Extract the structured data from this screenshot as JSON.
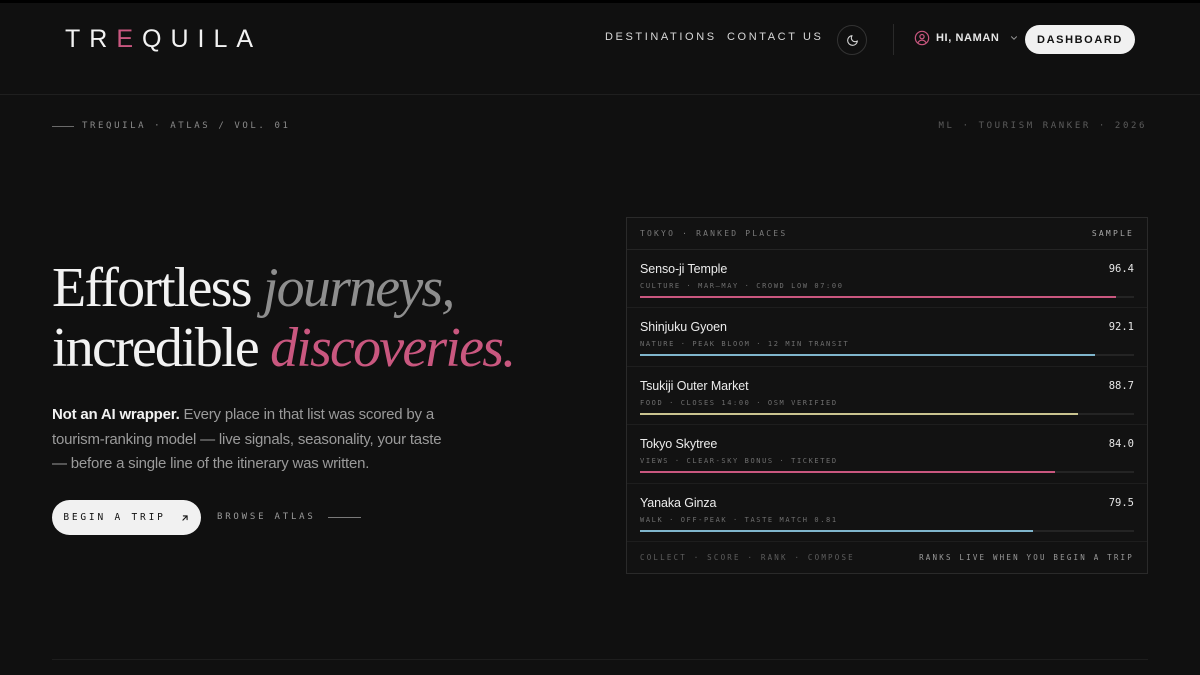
{
  "header": {
    "logo_pre": "TR",
    "logo_accent": "E",
    "logo_post": "QUILA",
    "nav": {
      "destinations": "DESTINATIONS",
      "contact": "CONTACT US"
    },
    "user_greeting": "HI, NAMAN",
    "dashboard_label": "DASHBOARD"
  },
  "meta": {
    "left": "TREQUILA · ATLAS / VOL. 01",
    "right": "ML · TOURISM RANKER · 2026"
  },
  "hero": {
    "line1_plain": "Effortless ",
    "line1_em": "journeys,",
    "line2_plain": "incredible ",
    "line2_em": "discoveries.",
    "body_strong": "Not an AI wrapper.",
    "body_rest": " Every place in that list was scored by a tourism-ranking model — live signals, seasonality, your taste — before a single line of the itinerary was written.",
    "begin_label": "BEGIN A TRIP",
    "browse_label": "BROWSE ATLAS"
  },
  "panel": {
    "title": "TOKYO · RANKED PLACES",
    "badge": "SAMPLE",
    "rows": [
      {
        "name": "Senso-ji Temple",
        "score": "96.4",
        "tags": "CULTURE · MAR–MAY · CROWD LOW 07:00",
        "fill": 0.964,
        "color": "#c9577f"
      },
      {
        "name": "Shinjuku Gyoen",
        "score": "92.1",
        "tags": "NATURE · PEAK BLOOM · 12 MIN TRANSIT",
        "fill": 0.921,
        "color": "#7fb5cc"
      },
      {
        "name": "Tsukiji Outer Market",
        "score": "88.7",
        "tags": "FOOD · CLOSES 14:00 · OSM VERIFIED",
        "fill": 0.887,
        "color": "#c9c38f"
      },
      {
        "name": "Tokyo Skytree",
        "score": "84.0",
        "tags": "VIEWS · CLEAR-SKY BONUS · TICKETED",
        "fill": 0.84,
        "color": "#c9577f"
      },
      {
        "name": "Yanaka Ginza",
        "score": "79.5",
        "tags": "WALK · OFF-PEAK · TASTE MATCH 0.81",
        "fill": 0.795,
        "color": "#7fb5cc"
      }
    ],
    "foot_left": "COLLECT · SCORE · RANK · COMPOSE",
    "foot_right": "RANKS LIVE WHEN YOU BEGIN A TRIP"
  },
  "icons": {
    "theme": "moon-icon",
    "user": "user-circle-icon",
    "chevron": "chevron-down-icon",
    "arrow": "arrow-up-right-icon"
  }
}
